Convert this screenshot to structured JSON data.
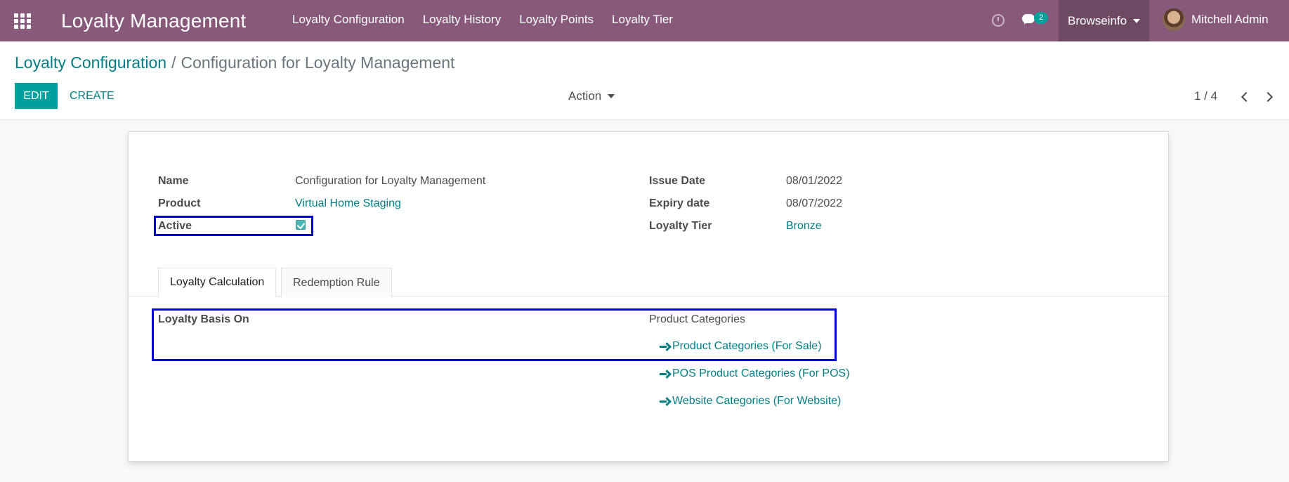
{
  "navbar": {
    "app_title": "Loyalty Management",
    "menu": [
      "Loyalty Configuration",
      "Loyalty History",
      "Loyalty Points",
      "Loyalty Tier"
    ],
    "message_count": "2",
    "company": "Browseinfo",
    "user": "Mitchell Admin",
    "bg_color": "#875a7b"
  },
  "breadcrumb": {
    "parent": "Loyalty Configuration",
    "separator": "/",
    "current": "Configuration for Loyalty Management"
  },
  "buttons": {
    "edit": "EDIT",
    "create": "CREATE",
    "action": "Action"
  },
  "pager": {
    "value": "1 / 4"
  },
  "form": {
    "name_label": "Name",
    "name_value": "Configuration for Loyalty Management",
    "product_label": "Product",
    "product_value": "Virtual Home Staging",
    "active_label": "Active",
    "active_checked": true,
    "issue_date_label": "Issue Date",
    "issue_date_value": "08/01/2022",
    "expiry_date_label": "Expiry date",
    "expiry_date_value": "08/07/2022",
    "tier_label": "Loyalty Tier",
    "tier_value": "Bronze"
  },
  "tabs": [
    "Loyalty Calculation",
    "Redemption Rule"
  ],
  "calculation": {
    "basis_label": "Loyalty Basis On",
    "basis_value": "Product Categories",
    "links": [
      "Product Categories (For Sale)",
      "POS Product Categories (For POS)",
      "Website Categories (For Website)"
    ]
  },
  "accent_color": "#017e84",
  "highlight_color": "#0000d6"
}
